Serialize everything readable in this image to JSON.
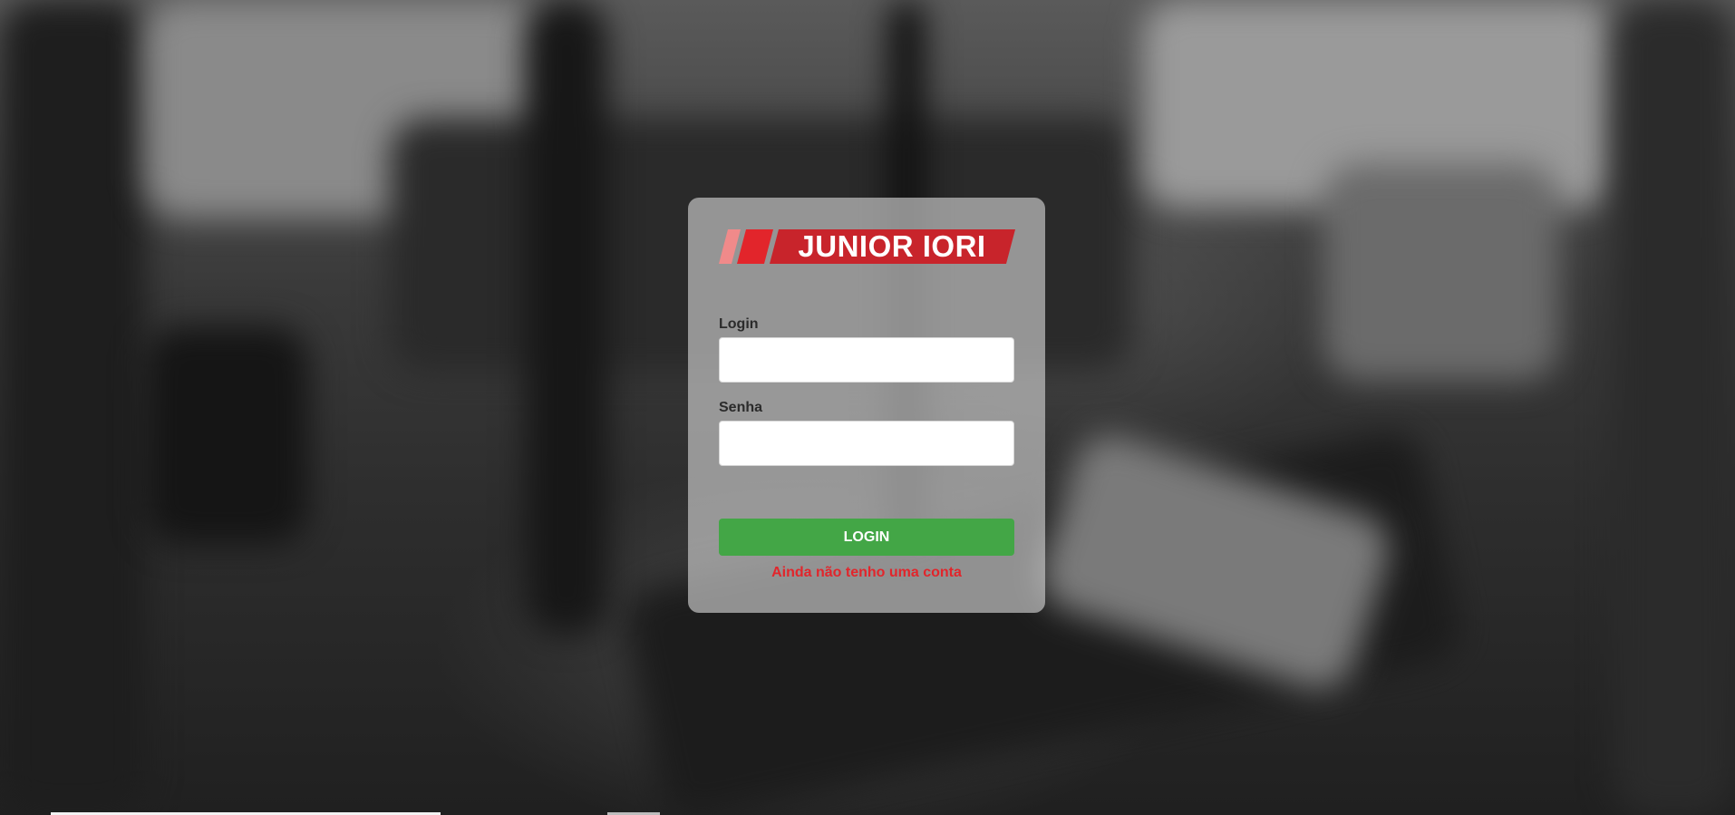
{
  "brand": {
    "logo_text": "JUNIOR IORI",
    "colors": {
      "logo_red": "#c8242b",
      "logo_red_light": "#f08a8a",
      "logo_red_mid": "#e2252b"
    }
  },
  "form": {
    "login_label": "Login",
    "login_value": "",
    "senha_label": "Senha",
    "senha_value": "",
    "submit_label": "LOGIN",
    "signup_link": "Ainda não tenho uma conta"
  },
  "theme": {
    "button_color": "#43a646",
    "link_color": "#e2252b"
  }
}
